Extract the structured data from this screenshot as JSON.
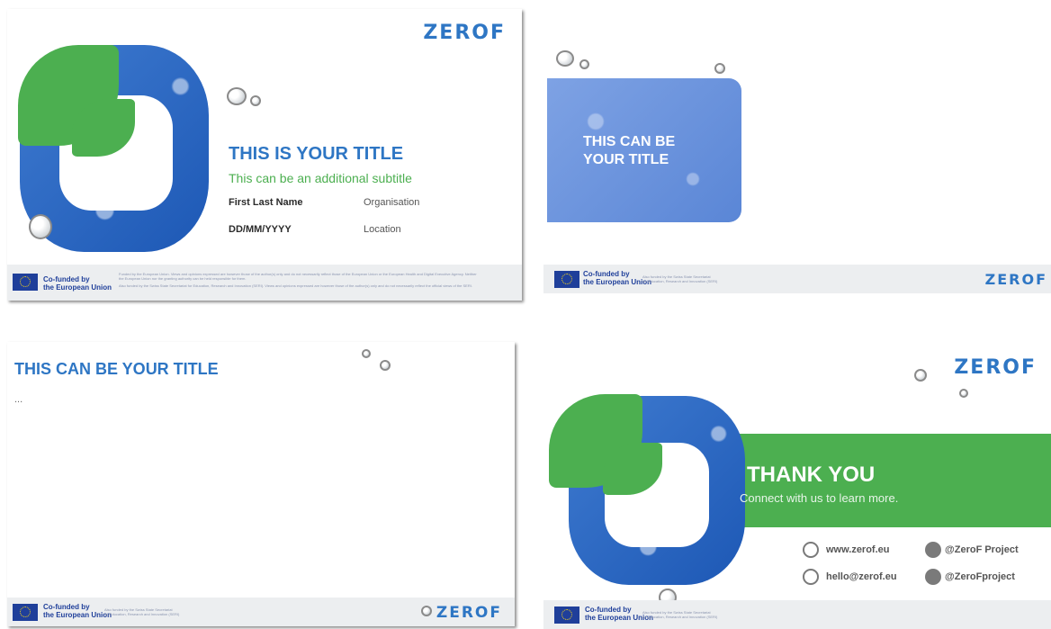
{
  "brand": {
    "logo_text": "ZEROF"
  },
  "footer": {
    "cofunded_line1": "Co-funded by",
    "cofunded_line2": "the European Union",
    "swiss_line1": "Also funded by the Swiss State Secretariat",
    "swiss_line2": "for Education, Research and Innovation (SERI)",
    "disclaimer_line1": "Funded by the European Union. Views and opinions expressed are however those of the author(s) only and do not necessarily reflect those of the European Union or the European Health and Digital Executive Agency. Neither",
    "disclaimer_line2": "the European Union nor the granting authority can be held responsible for them.",
    "disclaimer_line3": "Also funded by the Swiss State Secretariat for Education, Research and Innovation (SERI). Views and opinions expressed are however those of the author(s) only and do not necessarily reflect the official views of the SERI."
  },
  "slide1": {
    "title": "THIS IS YOUR TITLE",
    "subtitle": "This can be an additional subtitle",
    "name": "First Last Name",
    "organisation": "Organisation",
    "date": "DD/MM/YYYY",
    "location": "Location"
  },
  "slide2": {
    "title_line1": "THIS CAN BE",
    "title_line2": "YOUR TITLE"
  },
  "slide3": {
    "title": "THIS CAN BE YOUR TITLE",
    "body": "..."
  },
  "slide4": {
    "title": "THANK YOU",
    "subtitle": "Connect with us to learn more.",
    "website": "www.zerof.eu",
    "email": "hello@zerof.eu",
    "linkedin": "@ZeroF Project",
    "twitter": "@ZeroFproject"
  },
  "colors": {
    "blue": "#2e76c4",
    "green": "#4caf50",
    "eu_blue": "#1f3f9a",
    "footer_bg": "#eceef0"
  },
  "icons": [
    "eu-flag-icon",
    "globe-icon",
    "mail-icon",
    "linkedin-icon",
    "twitter-icon",
    "water-drop-icon"
  ]
}
